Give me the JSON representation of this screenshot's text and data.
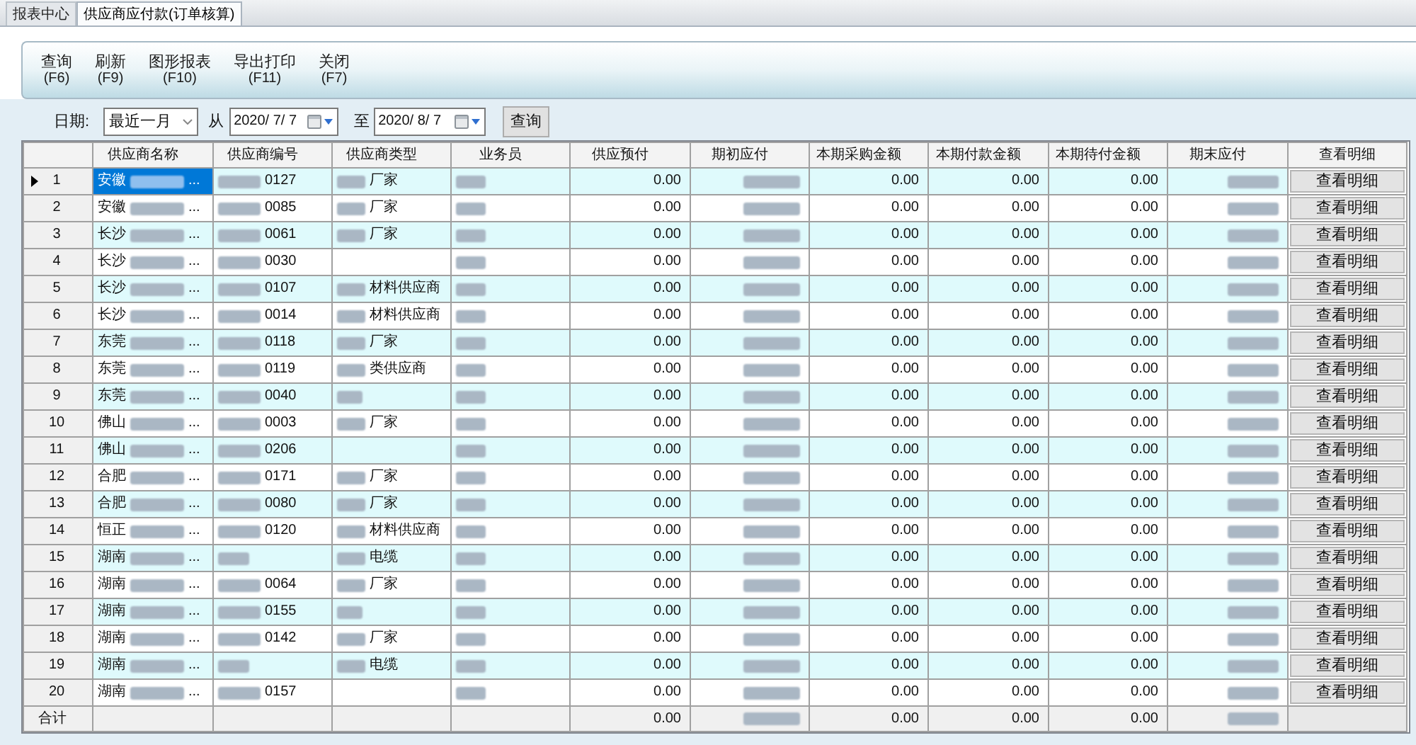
{
  "tabs": [
    {
      "label": "报表中心",
      "selected": false
    },
    {
      "label": "供应商应付款(订单核算)",
      "selected": true
    }
  ],
  "toolbar": [
    {
      "label": "查询",
      "shortcut": "(F6)"
    },
    {
      "label": "刷新",
      "shortcut": "(F9)"
    },
    {
      "label": "图形报表",
      "shortcut": "(F10)"
    },
    {
      "label": "导出打印",
      "shortcut": "(F11)"
    },
    {
      "label": "关闭",
      "shortcut": "(F7)"
    }
  ],
  "filter": {
    "date_label": "日期:",
    "period": "最近一月",
    "from_label": "从",
    "from_date": "2020/ 7/ 7",
    "to_label": "至",
    "to_date": "2020/ 8/ 7",
    "query_button": "查询"
  },
  "table": {
    "columns": [
      "供应商名称",
      "供应商编号",
      "供应商类型",
      "业务员",
      "供应预付",
      "期初应付",
      "本期采购金额",
      "本期付款金额",
      "本期待付金额",
      "期末应付",
      "查看明细"
    ],
    "rows": [
      {
        "no": "1",
        "selected": true,
        "name": [
          "安徽",
          {
            "kind": "blur"
          },
          "..."
        ],
        "code": [
          {
            "kind": "blur"
          },
          "0127"
        ],
        "type": [
          {
            "kind": "blur"
          },
          "厂家"
        ],
        "staff": [
          {
            "kind": "blur"
          }
        ],
        "prepay": "0.00",
        "opening": [
          {
            "kind": "blur"
          }
        ],
        "purchase": "0.00",
        "payment": "0.00",
        "pending": "0.00",
        "closing": [
          {
            "kind": "blur"
          }
        ],
        "detail": "查看明细"
      },
      {
        "no": "2",
        "selected": false,
        "name": [
          "安徽",
          {
            "kind": "blur"
          },
          "..."
        ],
        "code": [
          {
            "kind": "blur"
          },
          "0085"
        ],
        "type": [
          {
            "kind": "blur"
          },
          "厂家"
        ],
        "staff": [
          {
            "kind": "blur"
          }
        ],
        "prepay": "0.00",
        "opening": [
          {
            "kind": "blur"
          }
        ],
        "purchase": "0.00",
        "payment": "0.00",
        "pending": "0.00",
        "closing": [
          {
            "kind": "blur"
          }
        ],
        "detail": "查看明细"
      },
      {
        "no": "3",
        "selected": false,
        "name": [
          "长沙",
          {
            "kind": "blur"
          },
          "..."
        ],
        "code": [
          {
            "kind": "blur"
          },
          "0061"
        ],
        "type": [
          {
            "kind": "blur"
          },
          "厂家"
        ],
        "staff": [
          {
            "kind": "blur"
          }
        ],
        "prepay": "0.00",
        "opening": [
          {
            "kind": "blur"
          }
        ],
        "purchase": "0.00",
        "payment": "0.00",
        "pending": "0.00",
        "closing": [
          {
            "kind": "blur"
          }
        ],
        "detail": "查看明细"
      },
      {
        "no": "4",
        "selected": false,
        "name": [
          "长沙",
          {
            "kind": "blur"
          },
          "..."
        ],
        "code": [
          {
            "kind": "blur"
          },
          "0030"
        ],
        "staff": [
          {
            "kind": "blur"
          }
        ],
        "prepay": "0.00",
        "opening": [
          {
            "kind": "blur"
          }
        ],
        "purchase": "0.00",
        "payment": "0.00",
        "pending": "0.00",
        "closing": [
          {
            "kind": "blur"
          }
        ],
        "detail": "查看明细"
      },
      {
        "no": "5",
        "selected": false,
        "name": [
          "长沙",
          {
            "kind": "blur"
          },
          "..."
        ],
        "code": [
          {
            "kind": "blur"
          },
          "0107"
        ],
        "type": [
          {
            "kind": "blur"
          },
          "材料供应商"
        ],
        "staff": [
          {
            "kind": "blur"
          }
        ],
        "prepay": "0.00",
        "opening": [
          {
            "kind": "blur"
          }
        ],
        "purchase": "0.00",
        "payment": "0.00",
        "pending": "0.00",
        "closing": [
          {
            "kind": "blur"
          }
        ],
        "detail": "查看明细"
      },
      {
        "no": "6",
        "selected": false,
        "name": [
          "长沙",
          {
            "kind": "blur"
          },
          "..."
        ],
        "code": [
          {
            "kind": "blur"
          },
          "0014"
        ],
        "type": [
          {
            "kind": "blur"
          },
          "材料供应商"
        ],
        "staff": [
          {
            "kind": "blur"
          }
        ],
        "prepay": "0.00",
        "opening": [
          {
            "kind": "blur"
          }
        ],
        "purchase": "0.00",
        "payment": "0.00",
        "pending": "0.00",
        "closing": [
          {
            "kind": "blur"
          }
        ],
        "detail": "查看明细"
      },
      {
        "no": "7",
        "selected": false,
        "name": [
          "东莞",
          {
            "kind": "blur"
          },
          "..."
        ],
        "code": [
          {
            "kind": "blur"
          },
          "0118"
        ],
        "type": [
          {
            "kind": "blur"
          },
          "厂家"
        ],
        "staff": [
          {
            "kind": "blur"
          }
        ],
        "prepay": "0.00",
        "opening": [
          {
            "kind": "blur"
          }
        ],
        "purchase": "0.00",
        "payment": "0.00",
        "pending": "0.00",
        "closing": [
          {
            "kind": "blur"
          }
        ],
        "detail": "查看明细"
      },
      {
        "no": "8",
        "selected": false,
        "name": [
          "东莞",
          {
            "kind": "blur"
          },
          "..."
        ],
        "code": [
          {
            "kind": "blur"
          },
          "0119"
        ],
        "type": [
          {
            "kind": "blur"
          },
          "类供应商"
        ],
        "staff": [
          {
            "kind": "blur"
          }
        ],
        "prepay": "0.00",
        "opening": [
          {
            "kind": "blur"
          }
        ],
        "purchase": "0.00",
        "payment": "0.00",
        "pending": "0.00",
        "closing": [
          {
            "kind": "blur"
          }
        ],
        "detail": "查看明细"
      },
      {
        "no": "9",
        "selected": false,
        "name": [
          "东莞",
          {
            "kind": "blur"
          },
          "..."
        ],
        "code": [
          {
            "kind": "blur"
          },
          "0040"
        ],
        "type": [
          {
            "kind": "blur"
          }
        ],
        "staff": [
          {
            "kind": "blur"
          }
        ],
        "prepay": "0.00",
        "opening": [
          {
            "kind": "blur"
          }
        ],
        "purchase": "0.00",
        "payment": "0.00",
        "pending": "0.00",
        "closing": [
          {
            "kind": "blur"
          }
        ],
        "detail": "查看明细"
      },
      {
        "no": "10",
        "selected": false,
        "name": [
          "佛山",
          {
            "kind": "blur"
          },
          "..."
        ],
        "code": [
          {
            "kind": "blur"
          },
          "0003"
        ],
        "type": [
          {
            "kind": "blur"
          },
          "厂家"
        ],
        "staff": [
          {
            "kind": "blur"
          }
        ],
        "prepay": "0.00",
        "opening": [
          {
            "kind": "blur"
          }
        ],
        "purchase": "0.00",
        "payment": "0.00",
        "pending": "0.00",
        "closing": [
          {
            "kind": "blur"
          }
        ],
        "detail": "查看明细"
      },
      {
        "no": "11",
        "selected": false,
        "name": [
          "佛山",
          {
            "kind": "blur"
          },
          "..."
        ],
        "code": [
          {
            "kind": "blur"
          },
          "0206"
        ],
        "staff": [
          {
            "kind": "blur"
          }
        ],
        "prepay": "0.00",
        "opening": [
          {
            "kind": "blur"
          }
        ],
        "purchase": "0.00",
        "payment": "0.00",
        "pending": "0.00",
        "closing": [
          {
            "kind": "blur"
          }
        ],
        "detail": "查看明细"
      },
      {
        "no": "12",
        "selected": false,
        "name": [
          "合肥",
          {
            "kind": "blur"
          },
          "..."
        ],
        "code": [
          {
            "kind": "blur"
          },
          "0171"
        ],
        "type": [
          {
            "kind": "blur"
          },
          "厂家"
        ],
        "staff": [
          {
            "kind": "blur"
          }
        ],
        "prepay": "0.00",
        "opening": [
          {
            "kind": "blur"
          }
        ],
        "purchase": "0.00",
        "payment": "0.00",
        "pending": "0.00",
        "closing": [
          {
            "kind": "blur"
          }
        ],
        "detail": "查看明细"
      },
      {
        "no": "13",
        "selected": false,
        "name": [
          "合肥",
          {
            "kind": "blur"
          },
          "..."
        ],
        "code": [
          {
            "kind": "blur"
          },
          "0080"
        ],
        "type": [
          {
            "kind": "blur"
          },
          "厂家"
        ],
        "staff": [
          {
            "kind": "blur"
          }
        ],
        "prepay": "0.00",
        "opening": [
          {
            "kind": "blur"
          }
        ],
        "purchase": "0.00",
        "payment": "0.00",
        "pending": "0.00",
        "closing": [
          {
            "kind": "blur"
          }
        ],
        "detail": "查看明细"
      },
      {
        "no": "14",
        "selected": false,
        "name": [
          "恒正",
          {
            "kind": "blur"
          },
          "..."
        ],
        "code": [
          {
            "kind": "blur"
          },
          "0120"
        ],
        "type": [
          {
            "kind": "blur"
          },
          "材料供应商"
        ],
        "staff": [
          {
            "kind": "blur"
          }
        ],
        "prepay": "0.00",
        "opening": [
          {
            "kind": "blur"
          }
        ],
        "purchase": "0.00",
        "payment": "0.00",
        "pending": "0.00",
        "closing": [
          {
            "kind": "blur"
          }
        ],
        "detail": "查看明细"
      },
      {
        "no": "15",
        "selected": false,
        "name": [
          "湖南",
          {
            "kind": "blur"
          },
          "..."
        ],
        "code": [
          {
            "kind": "blur"
          }
        ],
        "type": [
          {
            "kind": "blur"
          },
          "电缆"
        ],
        "staff": [
          {
            "kind": "blur"
          }
        ],
        "prepay": "0.00",
        "opening": [
          {
            "kind": "blur"
          }
        ],
        "purchase": "0.00",
        "payment": "0.00",
        "pending": "0.00",
        "closing": [
          {
            "kind": "blur"
          }
        ],
        "detail": "查看明细"
      },
      {
        "no": "16",
        "selected": false,
        "name": [
          "湖南",
          {
            "kind": "blur"
          },
          "..."
        ],
        "code": [
          {
            "kind": "blur"
          },
          "0064"
        ],
        "type": [
          {
            "kind": "blur"
          },
          "厂家"
        ],
        "staff": [
          {
            "kind": "blur"
          }
        ],
        "prepay": "0.00",
        "opening": [
          {
            "kind": "blur"
          }
        ],
        "purchase": "0.00",
        "payment": "0.00",
        "pending": "0.00",
        "closing": [
          {
            "kind": "blur"
          }
        ],
        "detail": "查看明细"
      },
      {
        "no": "17",
        "selected": false,
        "name": [
          "湖南",
          {
            "kind": "blur"
          },
          "..."
        ],
        "code": [
          {
            "kind": "blur"
          },
          "0155"
        ],
        "type": [
          {
            "kind": "blur"
          }
        ],
        "staff": [
          {
            "kind": "blur"
          }
        ],
        "prepay": "0.00",
        "opening": [
          {
            "kind": "blur"
          }
        ],
        "purchase": "0.00",
        "payment": "0.00",
        "pending": "0.00",
        "closing": [
          {
            "kind": "blur"
          }
        ],
        "detail": "查看明细"
      },
      {
        "no": "18",
        "selected": false,
        "name": [
          "湖南",
          {
            "kind": "blur"
          },
          "..."
        ],
        "code": [
          {
            "kind": "blur"
          },
          "0142"
        ],
        "type": [
          {
            "kind": "blur"
          },
          "厂家"
        ],
        "staff": [
          {
            "kind": "blur"
          }
        ],
        "prepay": "0.00",
        "opening": [
          {
            "kind": "blur"
          }
        ],
        "purchase": "0.00",
        "payment": "0.00",
        "pending": "0.00",
        "closing": [
          {
            "kind": "blur"
          }
        ],
        "detail": "查看明细"
      },
      {
        "no": "19",
        "selected": false,
        "name": [
          "湖南",
          {
            "kind": "blur"
          },
          "..."
        ],
        "code": [
          {
            "kind": "blur"
          }
        ],
        "type": [
          {
            "kind": "blur"
          },
          "电缆"
        ],
        "staff": [
          {
            "kind": "blur"
          }
        ],
        "prepay": "0.00",
        "opening": [
          {
            "kind": "blur"
          }
        ],
        "purchase": "0.00",
        "payment": "0.00",
        "pending": "0.00",
        "closing": [
          {
            "kind": "blur"
          }
        ],
        "detail": "查看明细"
      },
      {
        "no": "20",
        "selected": false,
        "name": [
          "湖南",
          {
            "kind": "blur"
          },
          "..."
        ],
        "code": [
          {
            "kind": "blur"
          },
          "0157"
        ],
        "staff": [
          {
            "kind": "blur"
          }
        ],
        "prepay": "0.00",
        "opening": [
          {
            "kind": "blur"
          }
        ],
        "purchase": "0.00",
        "payment": "0.00",
        "pending": "0.00",
        "closing": [
          {
            "kind": "blur"
          }
        ],
        "detail": "查看明细"
      }
    ],
    "total": {
      "label": "合计",
      "prepay": "0.00",
      "opening": [
        {
          "kind": "blur"
        }
      ],
      "purchase": "0.00",
      "payment": "0.00",
      "pending": "0.00",
      "closing": [
        {
          "kind": "blur"
        }
      ]
    }
  }
}
